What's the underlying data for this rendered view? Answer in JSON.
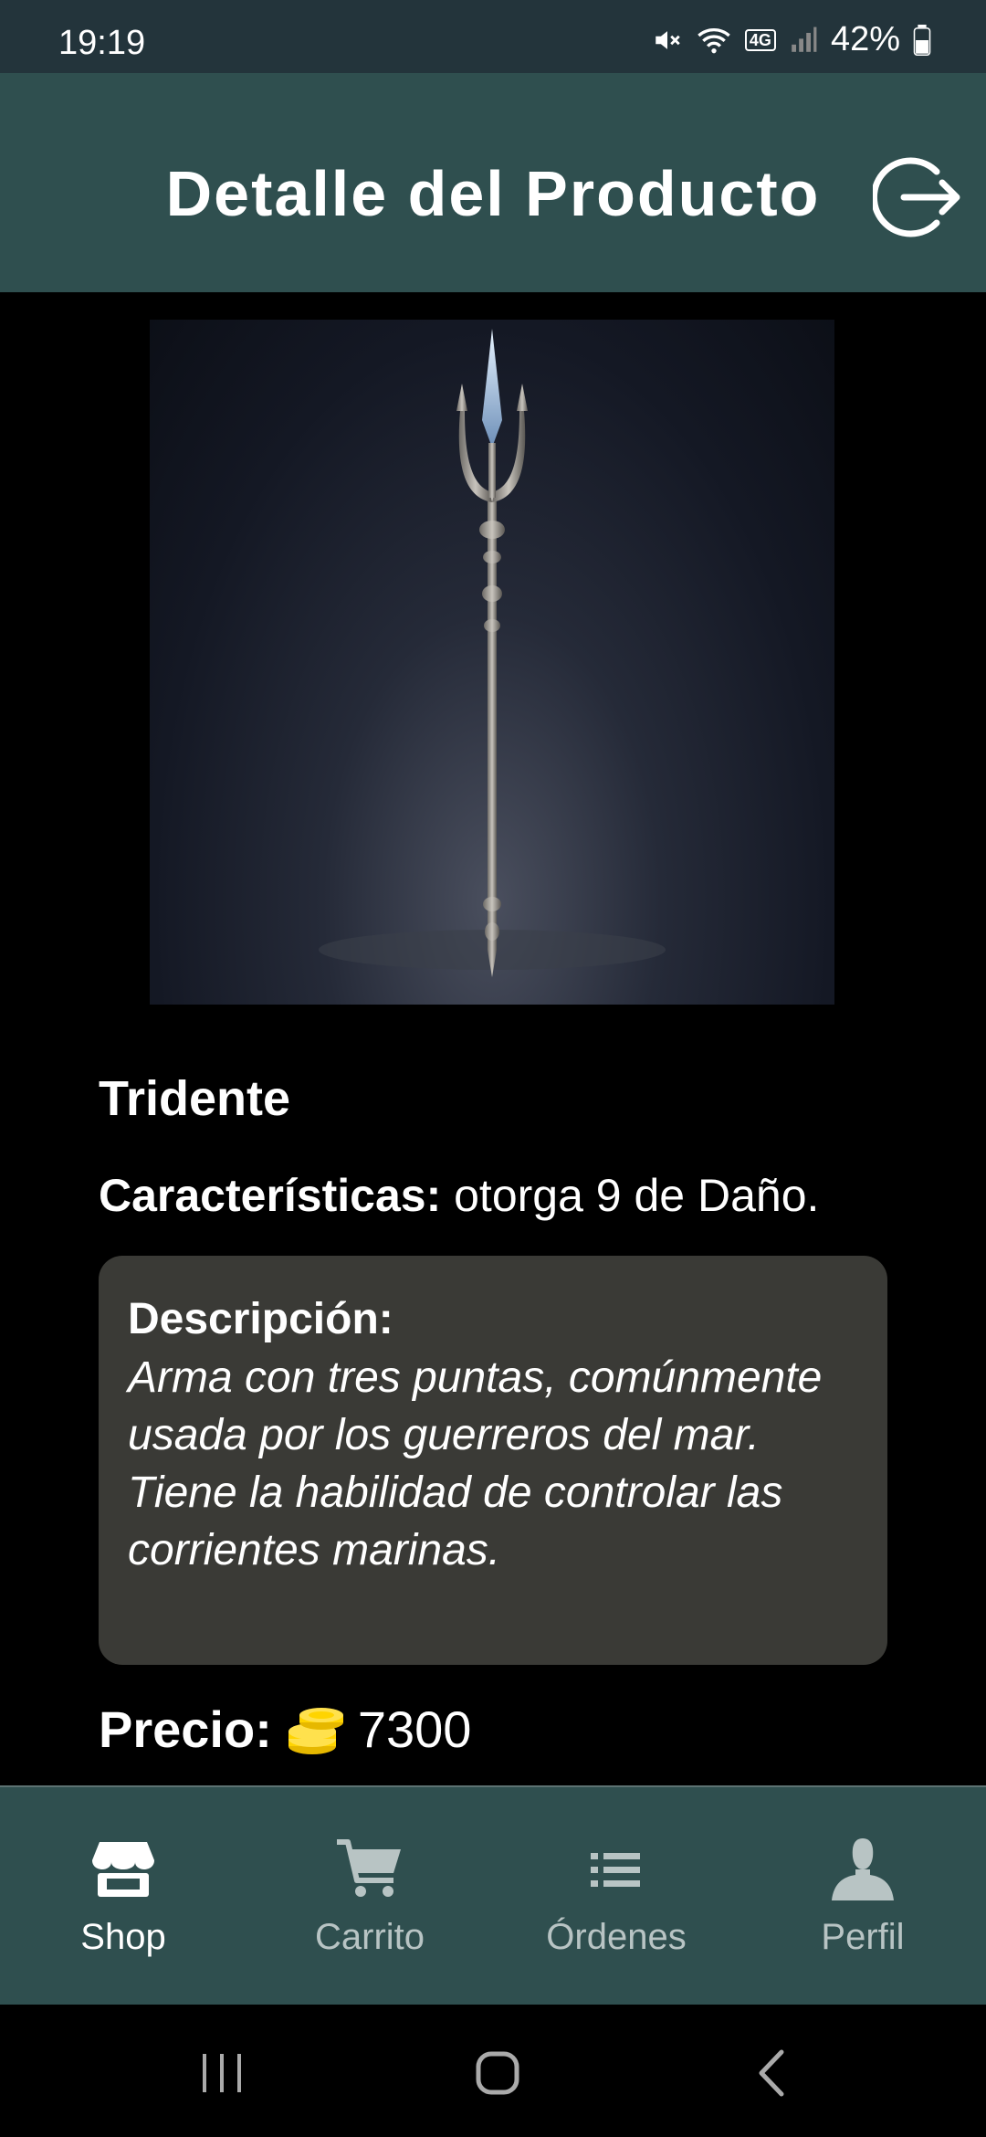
{
  "status_bar": {
    "time": "19:19",
    "battery": "42%",
    "network_label": "4G"
  },
  "header": {
    "title": "Detalle del Producto"
  },
  "product": {
    "name": "Tridente",
    "features_label": "Características:",
    "features_value": " otorga 9 de Daño.",
    "description_label": "Descripción:",
    "description": "Arma con tres puntas, comúnmente usada por los guerreros del mar. Tiene la habilidad de controlar las corrientes marinas.",
    "price_label": "Precio:",
    "price": "7300",
    "currency_icon": "coins-icon"
  },
  "nav": {
    "items": [
      {
        "label": "Shop",
        "icon": "store-icon",
        "active": true
      },
      {
        "label": "Carrito",
        "icon": "cart-icon",
        "active": false
      },
      {
        "label": "Órdenes",
        "icon": "list-icon",
        "active": false
      },
      {
        "label": "Perfil",
        "icon": "user-icon",
        "active": false
      }
    ]
  },
  "colors": {
    "header": "#2f4f4f",
    "status_bar": "#23343b",
    "card": "#3a3a36",
    "coin": "#ffd400"
  }
}
